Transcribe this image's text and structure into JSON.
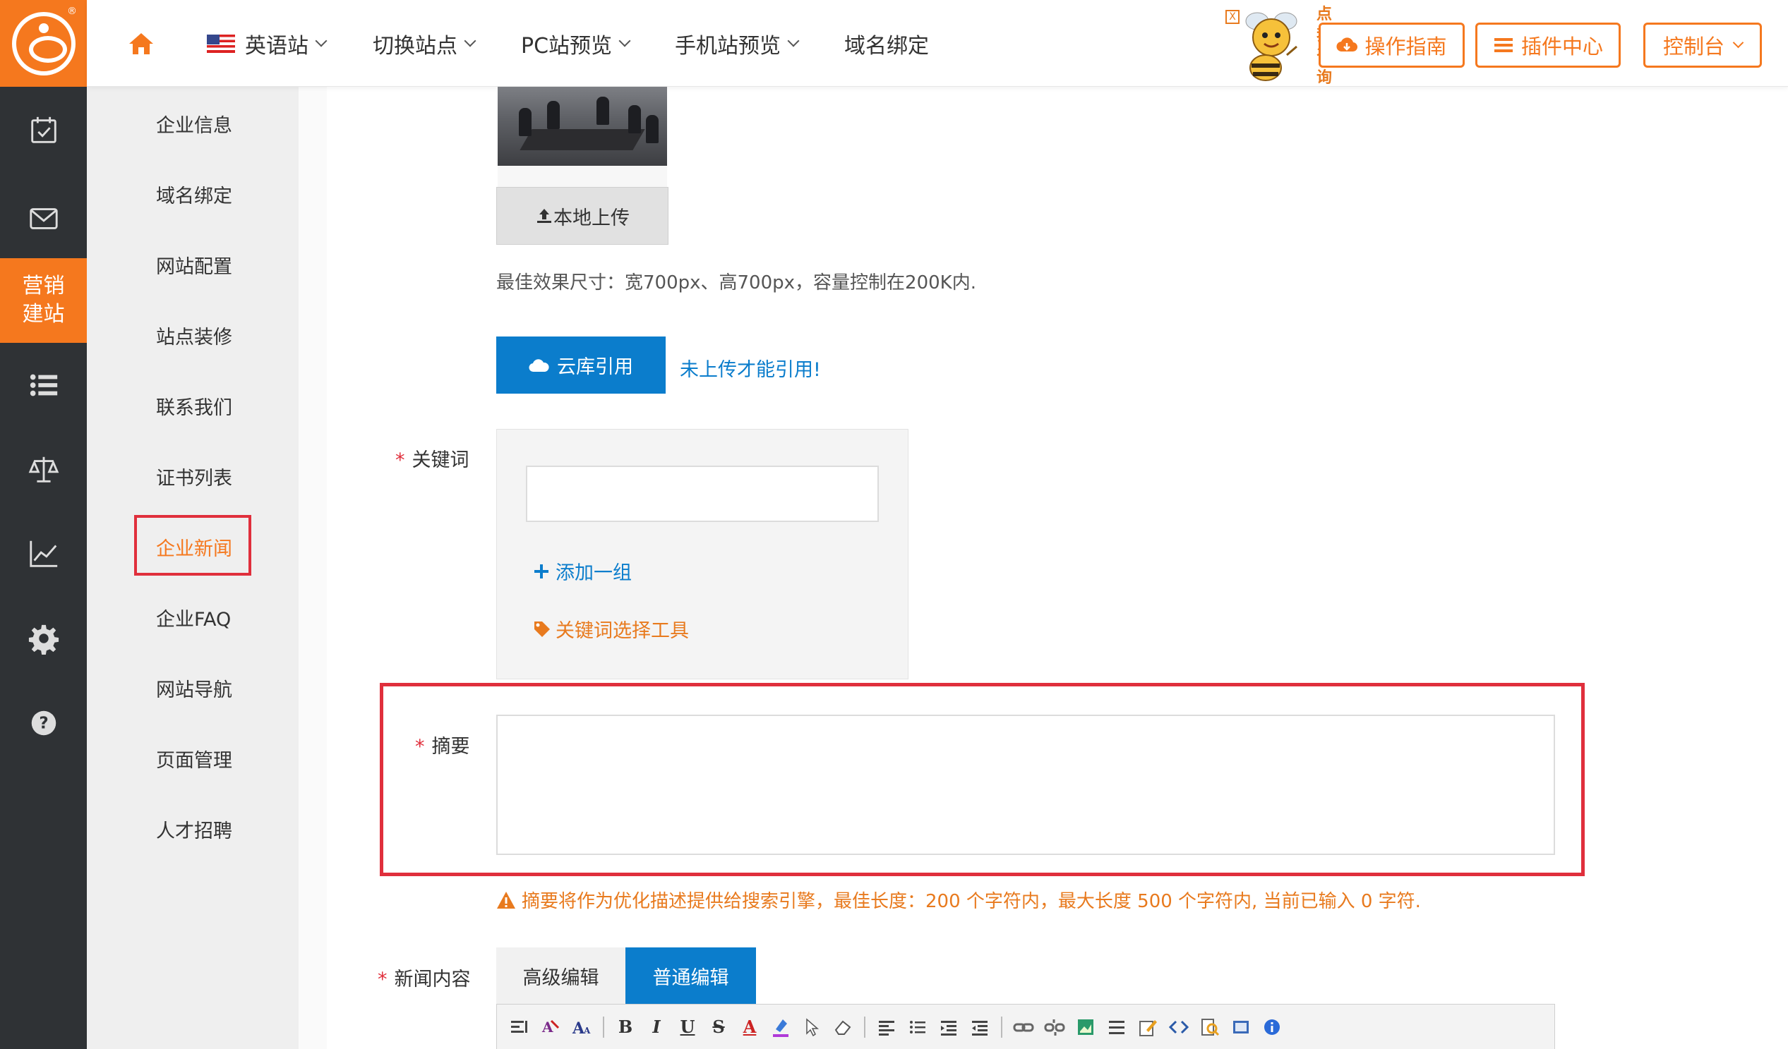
{
  "topbar": {
    "site_lang": "英语站",
    "switch_site": "切换站点",
    "pc_preview": "PC站预览",
    "mobile_preview": "手机站预览",
    "domain_bind": "域名绑定",
    "ad_text": "点我咨询",
    "ad_close": "X",
    "guide_btn": "操作指南",
    "plugin_btn": "插件中心",
    "console_btn": "控制台"
  },
  "rail": {
    "active_label_1": "营销",
    "active_label_2": "建站"
  },
  "subnav": {
    "items": [
      {
        "label": "企业信息"
      },
      {
        "label": "域名绑定"
      },
      {
        "label": "网站配置"
      },
      {
        "label": "站点装修"
      },
      {
        "label": "联系我们"
      },
      {
        "label": "证书列表"
      },
      {
        "label": "企业新闻"
      },
      {
        "label": "企业FAQ"
      },
      {
        "label": "网站导航"
      },
      {
        "label": "页面管理"
      },
      {
        "label": "人才招聘"
      }
    ]
  },
  "form": {
    "upload_label": "本地上传",
    "size_hint": "最佳效果尺寸：宽700px、高700px，容量控制在200K内.",
    "cloud_btn": "云库引用",
    "cloud_note": "未上传才能引用!",
    "required_mark": "*",
    "keyword_label": "关键词",
    "keyword_value": "",
    "add_group": "添加一组",
    "keyword_tool": "关键词选择工具",
    "summary_label": "摘要",
    "summary_value": "",
    "summary_warn": "摘要将作为优化描述提供给搜索引擎，最佳长度：200 个字符内，最大长度 500 个字符内, 当前已输入 0 字符.",
    "content_label": "新闻内容",
    "tab_advanced": "高级编辑",
    "tab_normal": "普通编辑"
  },
  "toolbar": {
    "bold": "B",
    "italic": "I",
    "underline": "U",
    "strike": "S",
    "font_color": "A"
  },
  "colors": {
    "accent": "#f5781e",
    "primary": "#0b7dcc",
    "highlight": "#e02f3c",
    "rail_bg": "#2f3235",
    "subnav_bg": "#efefef"
  }
}
